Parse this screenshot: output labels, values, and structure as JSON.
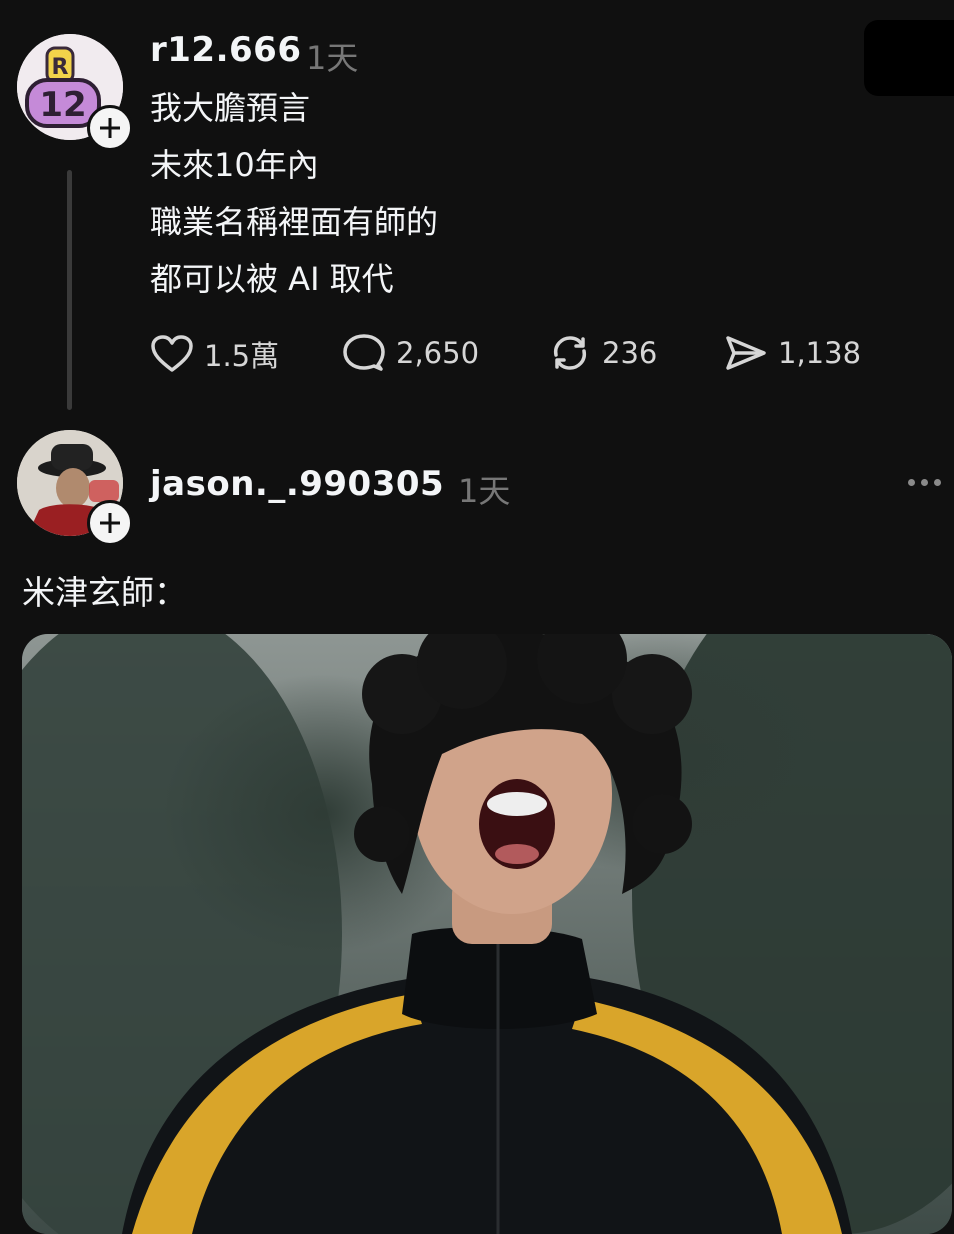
{
  "post": {
    "username": "r12.666",
    "time": "1天",
    "avatar_text": "12",
    "lines": [
      "我大膽預言",
      "未來10年內",
      "職業名稱裡面有師的",
      "都可以被 AI 取代"
    ],
    "actions": {
      "likes": "1.5萬",
      "comments": "2,650",
      "reposts": "236",
      "shares": "1,138"
    }
  },
  "reply": {
    "username": "jason._.990305",
    "time": "1天",
    "text": "米津玄師："
  },
  "icons": [
    "plus-icon",
    "heart-icon",
    "comment-icon",
    "repost-icon",
    "share-icon",
    "more-icon"
  ],
  "colors": {
    "background": "#101010",
    "text": "#f3f5f7",
    "muted": "#777777"
  }
}
